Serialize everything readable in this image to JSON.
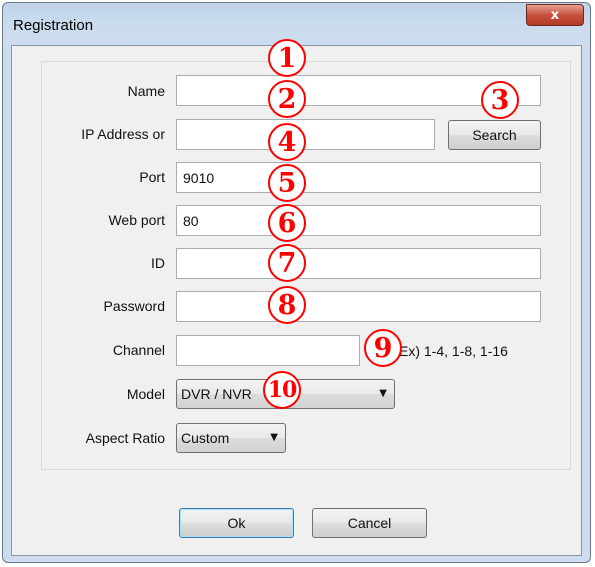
{
  "window": {
    "title": "Registration",
    "close_glyph": "x"
  },
  "form": {
    "name_label": "Name",
    "name_value": "",
    "ip_label": "IP Address or",
    "ip_value": "",
    "search_label": "Search",
    "port_label": "Port",
    "port_value": "9010",
    "webport_label": "Web port",
    "webport_value": "80",
    "id_label": "ID",
    "id_value": "",
    "password_label": "Password",
    "password_value": "",
    "channel_label": "Channel",
    "channel_value": "",
    "channel_hint": "Ex) 1-4, 1-8, 1-16",
    "model_label": "Model",
    "model_selected": "DVR / NVR",
    "aspect_label": "Aspect Ratio",
    "aspect_selected": "Custom"
  },
  "buttons": {
    "ok": "Ok",
    "cancel": "Cancel"
  },
  "markers": [
    "1",
    "2",
    "3",
    "4",
    "5",
    "6",
    "7",
    "8",
    "9",
    "10"
  ],
  "colors": {
    "marker": "#ff0000",
    "close_button": "#c7513d",
    "window_frame": "#c9dbee"
  }
}
